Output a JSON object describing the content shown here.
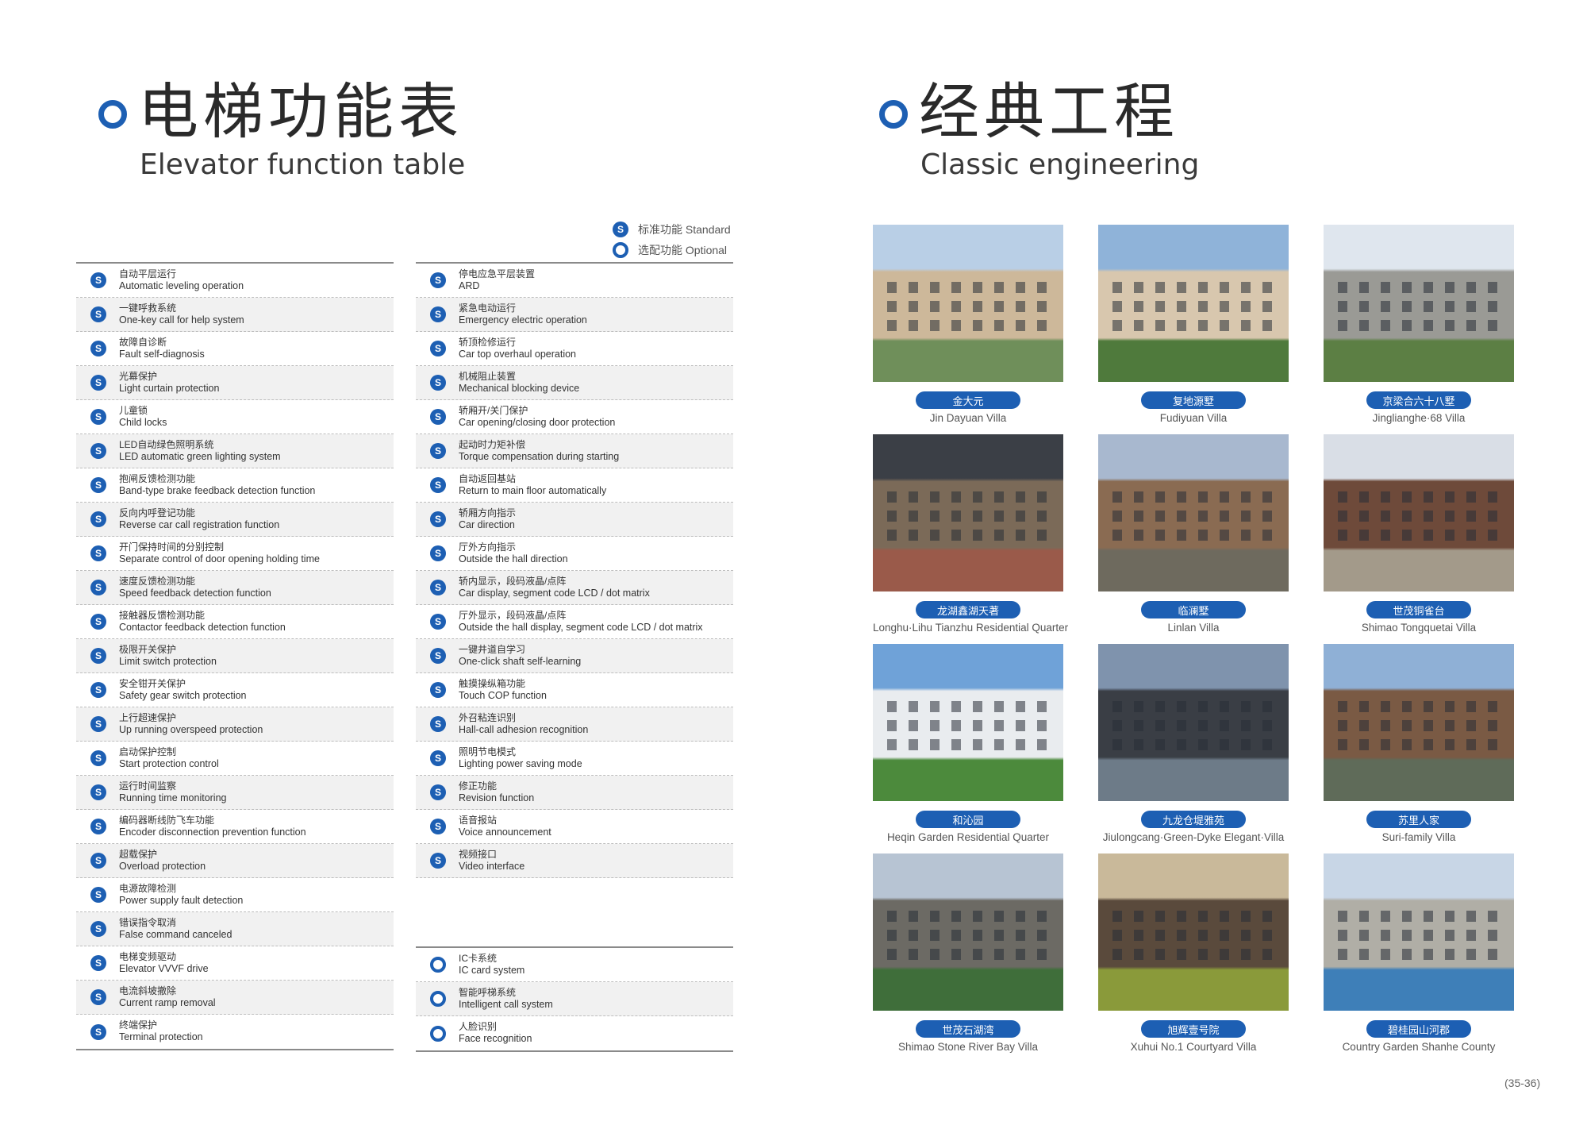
{
  "left_section": {
    "title_zh": "电梯功能表",
    "title_en": "Elevator function table"
  },
  "right_section": {
    "title_zh": "经典工程",
    "title_en": "Classic engineering"
  },
  "legend": {
    "standard": {
      "mark": "S",
      "label": "标准功能 Standard"
    },
    "optional": {
      "mark": "",
      "label": "选配功能 Optional"
    }
  },
  "left_table": [
    {
      "cn": "自动平层运行",
      "en": "Automatic leveling operation"
    },
    {
      "cn": "一键呼救系统",
      "en": "One-key call for help system"
    },
    {
      "cn": "故障自诊断",
      "en": "Fault self-diagnosis"
    },
    {
      "cn": "光幕保护",
      "en": "Light curtain protection"
    },
    {
      "cn": "儿童锁",
      "en": "Child locks"
    },
    {
      "cn": "LED自动绿色照明系统",
      "en": "LED automatic green lighting system"
    },
    {
      "cn": "抱闸反馈检测功能",
      "en": "Band-type brake feedback detection function"
    },
    {
      "cn": "反向内呼登记功能",
      "en": "Reverse car call registration function"
    },
    {
      "cn": "开门保持时间的分别控制",
      "en": "Separate control of door opening holding time"
    },
    {
      "cn": "速度反馈检测功能",
      "en": "Speed feedback detection function"
    },
    {
      "cn": "接触器反馈检测功能",
      "en": "Contactor feedback detection function"
    },
    {
      "cn": "极限开关保护",
      "en": "Limit switch protection"
    },
    {
      "cn": "安全钳开关保护",
      "en": "Safety gear switch protection"
    },
    {
      "cn": "上行超速保护",
      "en": "Up running overspeed protection"
    },
    {
      "cn": "启动保护控制",
      "en": "Start protection control"
    },
    {
      "cn": "运行时间监察",
      "en": "Running time monitoring"
    },
    {
      "cn": "编码器断线防飞车功能",
      "en": "Encoder disconnection prevention function"
    },
    {
      "cn": "超载保护",
      "en": "Overload protection"
    },
    {
      "cn": "电源故障检测",
      "en": "Power supply fault detection"
    },
    {
      "cn": "错误指令取消",
      "en": "False command canceled"
    },
    {
      "cn": "电梯变频驱动",
      "en": "Elevator VVVF drive"
    },
    {
      "cn": "电流斜坡撤除",
      "en": "Current ramp removal"
    },
    {
      "cn": "终端保护",
      "en": "Terminal protection"
    }
  ],
  "right_table_standard": [
    {
      "cn": "停电应急平层装置",
      "en": "ARD"
    },
    {
      "cn": "紧急电动运行",
      "en": "Emergency electric operation"
    },
    {
      "cn": "轿顶检修运行",
      "en": "Car top overhaul operation"
    },
    {
      "cn": "机械阻止装置",
      "en": "Mechanical blocking device"
    },
    {
      "cn": "轿厢开/关门保护",
      "en": "Car opening/closing door protection"
    },
    {
      "cn": "起动时力矩补偿",
      "en": "Torque compensation during starting"
    },
    {
      "cn": "自动返回基站",
      "en": "Return to main floor automatically"
    },
    {
      "cn": "轿厢方向指示",
      "en": "Car direction"
    },
    {
      "cn": "厅外方向指示",
      "en": "Outside the hall direction"
    },
    {
      "cn": "轿内显示，段码液晶/点阵",
      "en": "Car display, segment code LCD / dot matrix"
    },
    {
      "cn": "厅外显示，段码液晶/点阵",
      "en": "Outside the hall display, segment code LCD / dot matrix"
    },
    {
      "cn": "一键井道自学习",
      "en": "One-click shaft self-learning"
    },
    {
      "cn": "触摸操纵箱功能",
      "en": "Touch COP function"
    },
    {
      "cn": "外召粘连识别",
      "en": "Hall-call adhesion recognition"
    },
    {
      "cn": "照明节电模式",
      "en": "Lighting power saving mode"
    },
    {
      "cn": "修正功能",
      "en": "Revision function"
    },
    {
      "cn": "语音报站",
      "en": "Voice announcement"
    },
    {
      "cn": "视频接口",
      "en": "Video interface"
    }
  ],
  "right_table_optional": [
    {
      "cn": "IC卡系统",
      "en": "IC card system"
    },
    {
      "cn": "智能呼梯系统",
      "en": "Intelligent call system"
    },
    {
      "cn": "人脸识别",
      "en": "Face recognition"
    }
  ],
  "projects": [
    {
      "zh": "金大元",
      "en": "Jin Dayuan Villa",
      "colors": [
        "#b9cfe6",
        "#cdb89a",
        "#6f8f5a"
      ]
    },
    {
      "zh": "复地源墅",
      "en": "Fudiyuan Villa",
      "colors": [
        "#8fb3d9",
        "#d8c7ae",
        "#4f7a3c"
      ]
    },
    {
      "zh": "京梁合六十八墅",
      "en": "Jinglianghe·68 Villa",
      "colors": [
        "#dfe6ee",
        "#9a9a95",
        "#5c7f44"
      ]
    },
    {
      "zh": "龙湖鑫湖天著",
      "en": "Longhu·Lihu Tianzhu Residential Quarter",
      "colors": [
        "#3b3f46",
        "#7b6a58",
        "#9a5a4a"
      ]
    },
    {
      "zh": "临澜墅",
      "en": "Linlan Villa",
      "colors": [
        "#a8b8cf",
        "#8a6b52",
        "#6e6a5e"
      ]
    },
    {
      "zh": "世茂铜雀台",
      "en": "Shimao Tongquetai Villa",
      "colors": [
        "#d9dee6",
        "#6e4a3a",
        "#a39a8a"
      ]
    },
    {
      "zh": "和沁园",
      "en": "Heqin Garden Residential Quarter",
      "colors": [
        "#6fa2d8",
        "#e9ecef",
        "#4c8a3c"
      ]
    },
    {
      "zh": "九龙仓堤雅苑",
      "en": "Jiulongcang·Green-Dyke Elegant·Villa",
      "colors": [
        "#7f93ad",
        "#3a3e45",
        "#6d7b88"
      ]
    },
    {
      "zh": "苏里人家",
      "en": "Suri-family Villa",
      "colors": [
        "#8fb0d6",
        "#7a5a44",
        "#5f6b59"
      ]
    },
    {
      "zh": "世茂石湖湾",
      "en": "Shimao Stone River Bay Villa",
      "colors": [
        "#b7c4d3",
        "#6c6a64",
        "#3f6e3a"
      ]
    },
    {
      "zh": "旭辉壹号院",
      "en": "Xuhui No.1 Courtyard Villa",
      "colors": [
        "#c9b99a",
        "#5a4a3c",
        "#8a9a3a"
      ]
    },
    {
      "zh": "碧桂园山河郡",
      "en": "Country Garden Shanhe County",
      "colors": [
        "#c8d6e6",
        "#b0aea6",
        "#3e7fb8"
      ]
    }
  ],
  "page_number": "(35-36)"
}
